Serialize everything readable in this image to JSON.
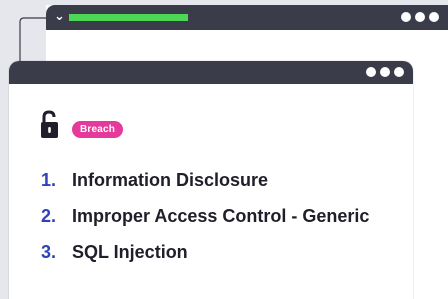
{
  "back_window": {
    "collapse_icon": "chevron-down-icon",
    "progress_color": "#4ed657",
    "menu_icon": "three-dots-icon"
  },
  "front_window": {
    "menu_icon": "three-dots-icon"
  },
  "status": {
    "icon": "unlocked-padlock-icon",
    "badge_label": "Breach",
    "badge_color": "#e5399c"
  },
  "vulnerabilities": [
    {
      "number": "1.",
      "name": "Information Disclosure"
    },
    {
      "number": "2.",
      "name": "Improper Access Control - Generic"
    },
    {
      "number": "3.",
      "name": "SQL Injection"
    }
  ],
  "colors": {
    "titlebar": "#3a3c49",
    "number": "#2f42b8",
    "text": "#1e1f2a",
    "background": "#e6e7ec"
  }
}
